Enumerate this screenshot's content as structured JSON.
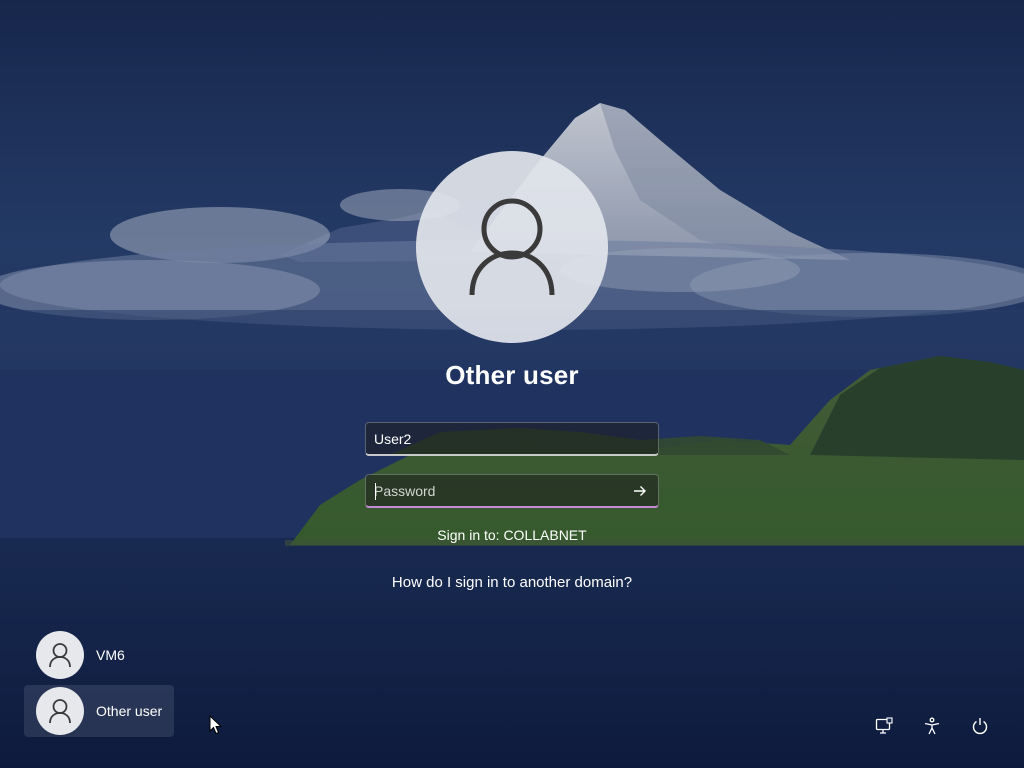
{
  "login": {
    "selected_user": "Other user",
    "username_value": "User2",
    "password_placeholder": "Password",
    "sign_in_to": "Sign in to: COLLABNET",
    "domain_help_link": "How do I sign in to another domain?"
  },
  "user_list": [
    {
      "name": "VM6",
      "selected": false
    },
    {
      "name": "Other user",
      "selected": true
    }
  ],
  "bottom_icons": [
    "network-icon",
    "accessibility-icon",
    "power-icon"
  ],
  "colors": {
    "text": "#ffffff",
    "password_focus_underline": "#c58ad8",
    "avatar_background": "#e6e8ec",
    "avatar_glyph": "#3a3a3a"
  }
}
